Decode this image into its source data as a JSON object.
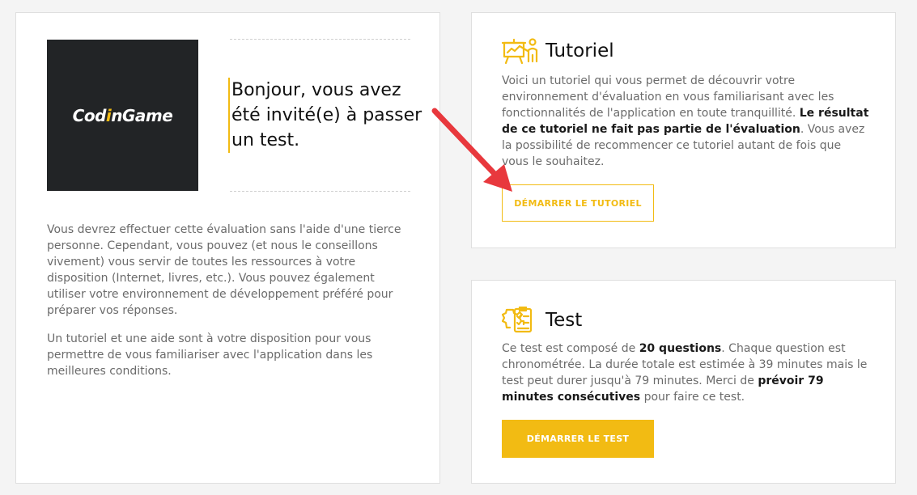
{
  "intro": {
    "logo_text_main": "Cod",
    "logo_text_accent": "i",
    "logo_text_rest": "nGame",
    "greeting": "Bonjour, vous avez été invité(e) à passer un test.",
    "paragraph1": "Vous devrez effectuer cette évaluation sans l'aide d'une tierce personne. Cependant, vous pouvez (et nous le conseillons vivement) vous servir de toutes les ressources à votre disposition (Internet, livres, etc.). Vous pouvez également utiliser votre environnement de développement préféré pour préparer vos réponses.",
    "paragraph2": "Un tutoriel et une aide sont à votre disposition pour vous permettre de vous familiariser avec l'application dans les meilleures conditions."
  },
  "tutorial": {
    "title": "Tutoriel",
    "text_start": "Voici un tutoriel qui vous permet de découvrir votre environnement d'évaluation en vous familiarisant avec les fonctionnalités de l'application en toute tranquillité. ",
    "text_bold": "Le résultat de ce tutoriel ne fait pas partie de l'évaluation",
    "text_end": ". Vous avez la possibilité de recommencer ce tutoriel autant de fois que vous le souhaitez.",
    "button_label": "DÉMARRER LE TUTORIEL"
  },
  "test": {
    "title": "Test",
    "text_1": "Ce test est composé de ",
    "text_bold_1": "20 questions",
    "text_2": ". Chaque question est chronométrée. La durée totale est estimée à 39 minutes mais le test peut durer jusqu'à 79 minutes. Merci de ",
    "text_bold_2": "prévoir 79 minutes consécutives",
    "text_3": " pour faire ce test.",
    "button_label": "DÉMARRER LE TEST"
  },
  "colors": {
    "accent": "#f2bb13",
    "logo_bg": "#222426",
    "annotation_arrow": "#e8383d"
  },
  "icons": {
    "tutorial": "presentation-board-icon",
    "test": "checklist-gear-icon",
    "annotation": "red-arrow-icon"
  }
}
